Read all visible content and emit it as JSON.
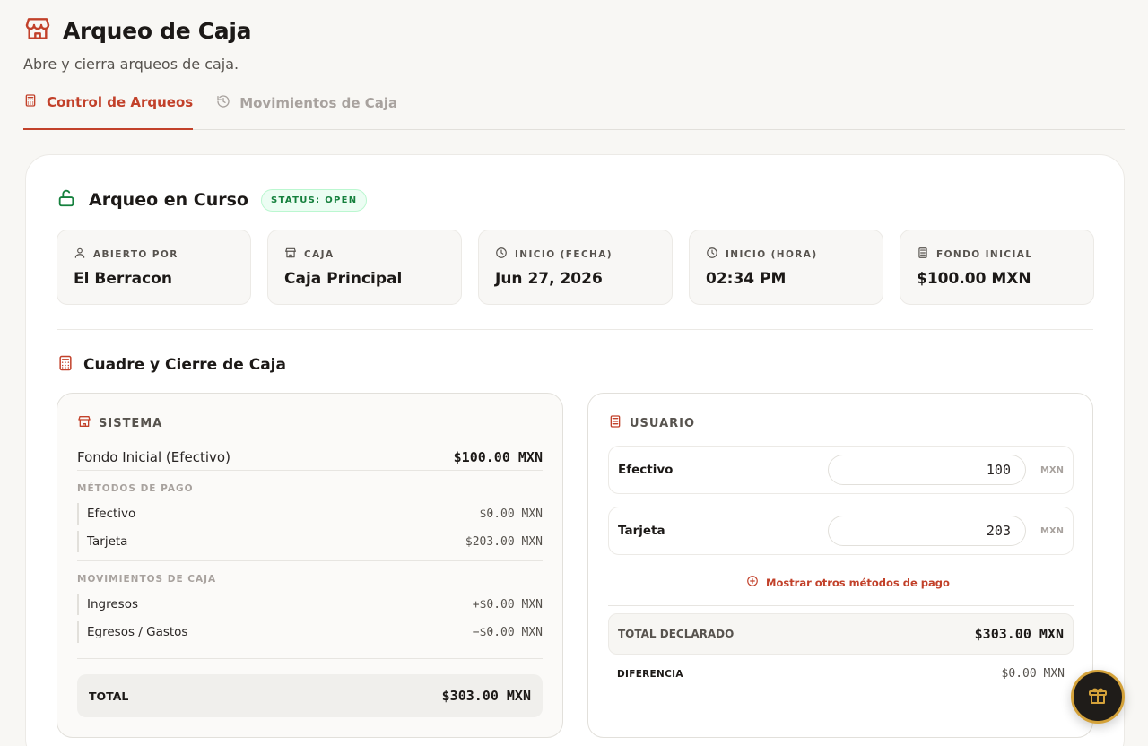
{
  "header": {
    "title": "Arqueo de Caja",
    "subtitle": "Abre y cierra arqueos de caja.",
    "icon": "store-icon"
  },
  "tabs": [
    {
      "label": "Control de Arqueos",
      "icon": "calculator-icon",
      "active": true
    },
    {
      "label": "Movimientos de Caja",
      "icon": "history-icon",
      "active": false
    }
  ],
  "arqueo": {
    "title": "Arqueo en Curso",
    "status": "STATUS: OPEN",
    "info": [
      {
        "label": "ABIERTO POR",
        "value": "El Berracon",
        "icon": "user-icon"
      },
      {
        "label": "CAJA",
        "value": "Caja Principal",
        "icon": "store-icon"
      },
      {
        "label": "INICIO (FECHA)",
        "value": "Jun 27, 2026",
        "icon": "clock-icon"
      },
      {
        "label": "INICIO (HORA)",
        "value": "02:34 PM",
        "icon": "clock-icon"
      },
      {
        "label": "FONDO INICIAL",
        "value": "$100.00 MXN",
        "icon": "calculator-icon"
      }
    ]
  },
  "cuadre": {
    "title": "Cuadre y Cierre de Caja",
    "sistema": {
      "heading": "SISTEMA",
      "fondo_label": "Fondo Inicial (Efectivo)",
      "fondo_value": "$100.00 MXN",
      "metodos_label": "MÉTODOS DE PAGO",
      "metodos": [
        {
          "label": "Efectivo",
          "value": "$0.00 MXN"
        },
        {
          "label": "Tarjeta",
          "value": "$203.00 MXN"
        }
      ],
      "movimientos_label": "MOVIMIENTOS DE CAJA",
      "movimientos": [
        {
          "label": "Ingresos",
          "value": "+$0.00 MXN"
        },
        {
          "label": "Egresos / Gastos",
          "value": "−$0.00 MXN"
        }
      ],
      "total_label": "TOTAL",
      "total_value": "$303.00 MXN"
    },
    "usuario": {
      "heading": "USUARIO",
      "inputs": [
        {
          "label": "Efectivo",
          "value": "100",
          "unit": "MXN"
        },
        {
          "label": "Tarjeta",
          "value": "203",
          "unit": "MXN"
        }
      ],
      "more_link": "Mostrar otros métodos de pago",
      "declarado_label": "TOTAL DECLARADO",
      "declarado_value": "$303.00 MXN",
      "diferencia_label": "DIFERENCIA",
      "diferencia_value": "$0.00 MXN"
    }
  },
  "colors": {
    "accent": "#c2412a",
    "status_green": "#15803d",
    "fab_ring": "#d4a23a"
  },
  "fab": {
    "icon": "gift-icon"
  }
}
